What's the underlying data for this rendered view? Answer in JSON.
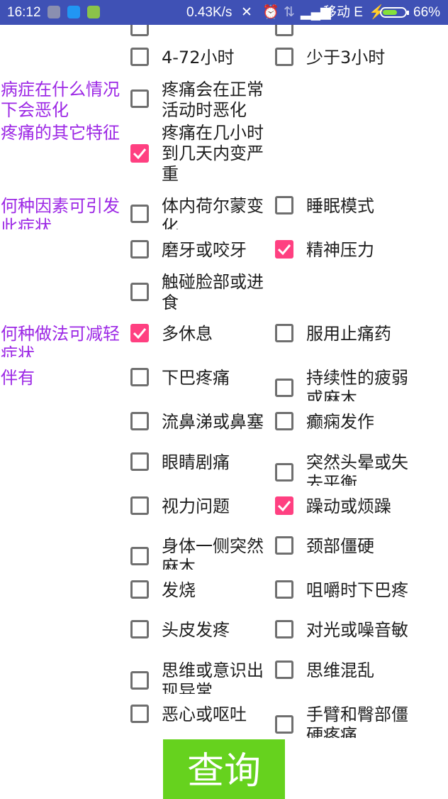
{
  "statusbar": {
    "time": "16:12",
    "network_speed": "0.43K/s",
    "carrier": "移动 E",
    "battery": "66%",
    "battery_level": 0.66
  },
  "labels": {
    "worse": "病症在什么情况下会恶化",
    "other_features": "疼痛的其它特征",
    "triggers": "何种因素可引发此症状",
    "relief": "何种做法可减轻症状",
    "accompanied": "伴有"
  },
  "options": {
    "dur_4_72": {
      "label": "4-72小时",
      "checked": false
    },
    "dur_lt3": {
      "label": "少于3小时",
      "checked": false
    },
    "worse_activity": {
      "label": "疼痛会在正常活动时恶化",
      "checked": false
    },
    "worse_days": {
      "label": "疼痛在几小时到几天内变严重",
      "checked": true
    },
    "trig_hormone": {
      "label": "体内荷尔蒙变化",
      "checked": false
    },
    "trig_sleep": {
      "label": "睡眠模式",
      "checked": false
    },
    "trig_grind": {
      "label": "磨牙或咬牙",
      "checked": false
    },
    "trig_stress": {
      "label": "精神压力",
      "checked": true
    },
    "trig_touch": {
      "label": "触碰脸部或进食",
      "checked": false
    },
    "rel_rest": {
      "label": "多休息",
      "checked": true
    },
    "rel_med": {
      "label": "服用止痛药",
      "checked": false
    },
    "acc_jaw": {
      "label": "下巴疼痛",
      "checked": false
    },
    "acc_weak": {
      "label": "持续性的疲弱或麻木",
      "checked": false
    },
    "acc_nose": {
      "label": "流鼻涕或鼻塞",
      "checked": false
    },
    "acc_seizure": {
      "label": "癫痫发作",
      "checked": false
    },
    "acc_eye": {
      "label": "眼睛剧痛",
      "checked": false
    },
    "acc_dizzy": {
      "label": "突然头晕或失去平衡",
      "checked": false
    },
    "acc_vision": {
      "label": "视力问题",
      "checked": false
    },
    "acc_restless": {
      "label": "躁动或烦躁",
      "checked": true
    },
    "acc_numb": {
      "label": "身体一侧突然麻木",
      "checked": false
    },
    "acc_neck": {
      "label": "颈部僵硬",
      "checked": false
    },
    "acc_fever": {
      "label": "发烧",
      "checked": false
    },
    "acc_chew": {
      "label": "咀嚼时下巴疼痛",
      "checked": false
    },
    "acc_scalp": {
      "label": "头皮发疼",
      "checked": false
    },
    "acc_light": {
      "label": "对光或噪音敏感",
      "checked": false
    },
    "acc_mind": {
      "label": "思维或意识出现异常",
      "checked": false
    },
    "acc_confused": {
      "label": "思维混乱",
      "checked": false
    },
    "acc_nausea": {
      "label": "恶心或呕吐",
      "checked": false
    },
    "acc_arm": {
      "label": "手臂和臀部僵硬疼痛",
      "checked": false
    }
  },
  "query_button": "查询",
  "colors": {
    "accent": "#FF4081",
    "label": "#9C27E5",
    "button": "#66D21E",
    "statusbar": "#3F51B5"
  }
}
